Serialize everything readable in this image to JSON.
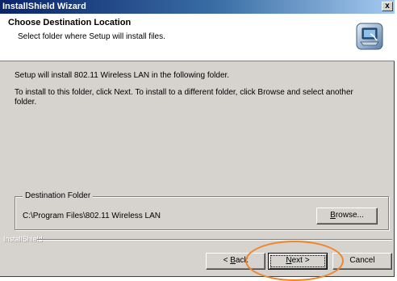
{
  "window": {
    "title": "InstallShield Wizard",
    "close_glyph": "x"
  },
  "header": {
    "title": "Choose Destination Location",
    "subtitle": "Select folder where Setup will install files.",
    "icon": "installer-computer-icon"
  },
  "body": {
    "line1": "Setup will install 802.11 Wireless LAN in the following folder.",
    "line2": "To install to this folder, click Next. To install to a different folder, click Browse and select another folder."
  },
  "destination": {
    "group_label": "Destination Folder",
    "path": "C:\\Program Files\\802.11 Wireless LAN",
    "browse_label": "Browse...",
    "browse_accel": "B",
    "browse_rest": "rowse..."
  },
  "footer": {
    "brand": "InstallShield",
    "back_label": "< Back",
    "back_prefix": "< ",
    "back_accel": "B",
    "back_rest": "ack",
    "next_label": "Next >",
    "next_accel": "N",
    "next_rest": "ext >",
    "cancel_label": "Cancel"
  },
  "colors": {
    "title_bar": "#0a246a",
    "face": "#d6d3ce",
    "highlight_ring": "#f0852a"
  }
}
